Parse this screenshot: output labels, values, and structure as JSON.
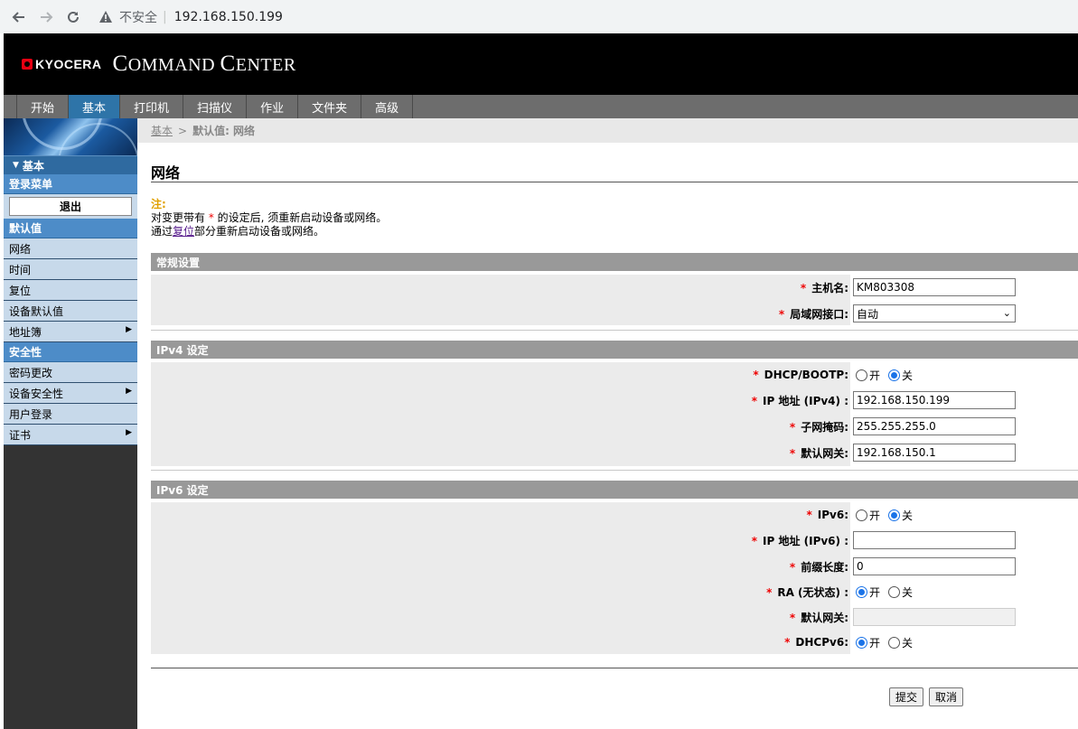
{
  "browser": {
    "insecure_label": "不安全",
    "url": "192.168.150.199"
  },
  "header": {
    "brand": "KYOCERA",
    "title_part1": "C",
    "title_part2": "OMMAND ",
    "title_part3": "C",
    "title_part4": "ENTER"
  },
  "topnav": {
    "tabs": [
      {
        "label": "开始"
      },
      {
        "label": "基本"
      },
      {
        "label": "打印机"
      },
      {
        "label": "扫描仪"
      },
      {
        "label": "作业"
      },
      {
        "label": "文件夹"
      },
      {
        "label": "高级"
      }
    ],
    "active": "基本"
  },
  "sidebar": {
    "section": "基本",
    "login_menu": "登录菜单",
    "logout": "退出",
    "defaults_head": "默认值",
    "defaults_items": [
      "网络",
      "时间",
      "复位",
      "设备默认值",
      "地址簿"
    ],
    "security_head": "安全性",
    "security_items": [
      "密码更改",
      "设备安全性",
      "用户登录",
      "证书"
    ]
  },
  "breadcrumb": {
    "parent": "基本",
    "current": "默认值: 网络"
  },
  "page": {
    "title": "网络",
    "note_label": "注:",
    "note_line1_a": "对变更带有 ",
    "note_star": "*",
    "note_line1_b": " 的设定后, 须重新启动设备或网络。",
    "note_line2_a": "通过",
    "note_line2_link": "复位",
    "note_line2_b": "部分重新启动设备或网络。"
  },
  "general": {
    "header": "常规设置",
    "hostname_label": "主机名:",
    "hostname_value": "KM803308",
    "lan_label": "局域网接口:",
    "lan_value": "自动"
  },
  "ipv4": {
    "header": "IPv4 设定",
    "dhcp_label": "DHCP/BOOTP:",
    "dhcp_on": "开",
    "dhcp_off": "关",
    "dhcp_selected": "off",
    "ip_label": "IP 地址 (IPv4) :",
    "ip_value": "192.168.150.199",
    "mask_label": "子网掩码:",
    "mask_value": "255.255.255.0",
    "gateway_label": "默认网关:",
    "gateway_value": "192.168.150.1"
  },
  "ipv6": {
    "header": "IPv6 设定",
    "ipv6_label": "IPv6:",
    "ipv6_on": "开",
    "ipv6_off": "关",
    "ipv6_selected": "off",
    "ip_label": "IP 地址 (IPv6) :",
    "ip_value": "",
    "prefix_label": "前缀长度:",
    "prefix_value": "0",
    "ra_label": "RA  (无状态) :",
    "ra_on": "开",
    "ra_off": "关",
    "ra_selected": "on",
    "gateway_label": "默认网关:",
    "gateway_value": "",
    "dhcpv6_label": "DHCPv6:",
    "dhcpv6_on": "开",
    "dhcpv6_off": "关",
    "dhcpv6_selected": "on"
  },
  "buttons": {
    "submit": "提交",
    "cancel": "取消"
  }
}
